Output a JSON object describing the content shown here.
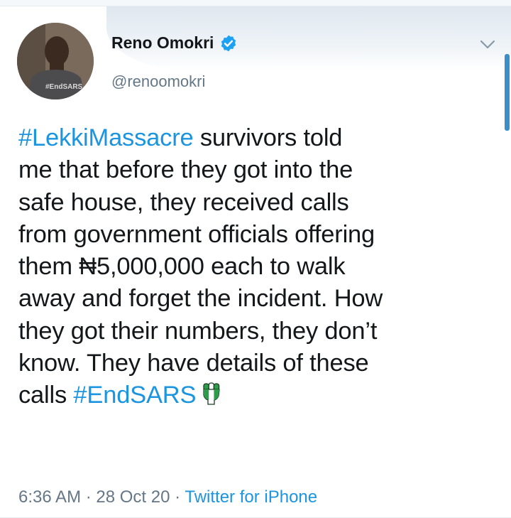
{
  "tweet": {
    "author_name": "Reno Omokri",
    "author_handle": "@renoomokri",
    "avatar_shirt_text": "#EndSARS",
    "hashtag_lekki": "#LekkiMassacre",
    "line1_rest": " survivors told",
    "line2": "me that before they got into the",
    "line3": "safe house, they received calls",
    "line4": "from government officials offering",
    "line5": "them ₦5,000,000 each to walk",
    "line6": "away and forget the incident. How",
    "line7": "they got their numbers, they don’t",
    "line8": "know. They have details of these",
    "line9_start": "calls ",
    "hashtag_endsars": "#EndSARS",
    "time": "6:36 AM",
    "separator1": " · ",
    "date": "28 Oct 20",
    "separator2": " · ",
    "source": "Twitter for iPhone"
  },
  "icons": {
    "verified": "verified-badge-icon",
    "chevron": "chevron-down-icon",
    "fist": "raised-fist-emoji"
  },
  "colors": {
    "link": "#1b95e0",
    "verified": "#1da1f2",
    "secondary_text": "#657786",
    "fist_green": "#2e9d4a"
  }
}
